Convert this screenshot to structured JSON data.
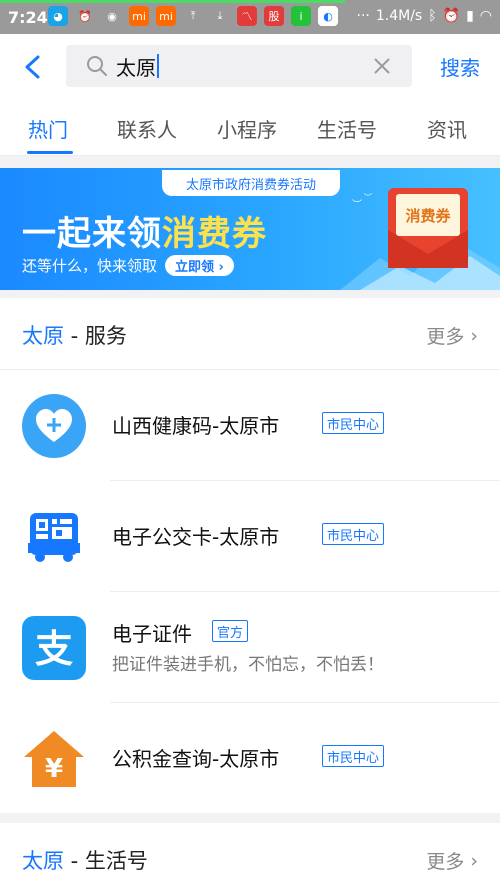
{
  "status_bar": {
    "time": "7:24",
    "net_speed": "1.4M/s",
    "more": "···",
    "icons": [
      "qq-icon",
      "alarm-icon",
      "weibo-icon",
      "mi-icon",
      "mi-icon",
      "upload-icon",
      "download-icon",
      "stock-icon",
      "news-icon",
      "iqiyi-icon",
      "browser-icon"
    ]
  },
  "search": {
    "query": "太原",
    "button_label": "搜索"
  },
  "tabs": [
    "热门",
    "联系人",
    "小程序",
    "生活号",
    "资讯"
  ],
  "banner": {
    "tag": "太原市政府消费券活动",
    "title_prefix": "一起来领",
    "title_highlight": "消费券",
    "subtitle": "还等什么，快来领取",
    "cta": "立即领",
    "coupon_label": "消费券"
  },
  "service_section": {
    "keyword": "太原",
    "title_suffix": " - 服务",
    "more_label": "更多",
    "items": [
      {
        "name": "山西健康码-太原市",
        "badge": "市民中心",
        "icon": "health-heart-icon",
        "desc": ""
      },
      {
        "name": "电子公交卡-太原市",
        "badge": "市民中心",
        "icon": "bus-card-icon",
        "desc": ""
      },
      {
        "name": "电子证件",
        "badge": "官方",
        "icon": "alipay-icon",
        "desc": "把证件装进手机，不怕忘，不怕丢！"
      },
      {
        "name": "公积金查询-太原市",
        "badge": "市民中心",
        "icon": "housing-fund-icon",
        "desc": ""
      }
    ]
  },
  "life_section": {
    "keyword": "太原",
    "title_suffix": " - 生活号",
    "more_label": "更多"
  },
  "colors": {
    "accent": "#1677ff",
    "banner_highlight": "#ffe14b",
    "fund_orange": "#f08a24"
  }
}
